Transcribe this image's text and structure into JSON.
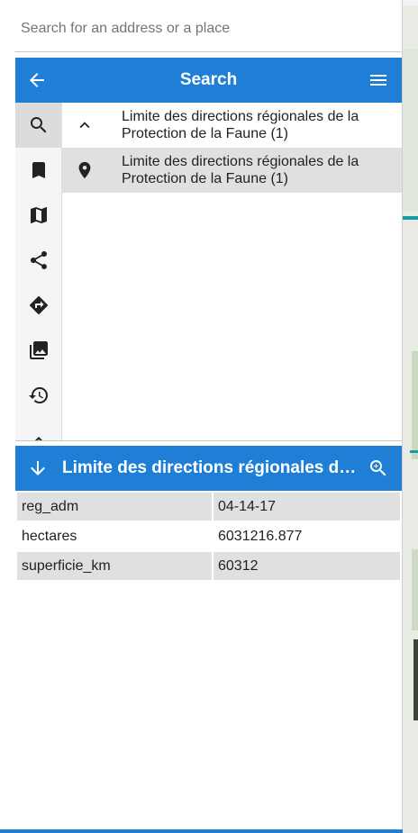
{
  "search": {
    "placeholder": "Search for an address or a place"
  },
  "header": {
    "title": "Search"
  },
  "sidebar": {
    "items": [
      {
        "icon": "search-icon",
        "active": true
      },
      {
        "icon": "bookmark-icon"
      },
      {
        "icon": "map-icon"
      },
      {
        "icon": "share-icon"
      },
      {
        "icon": "directions-icon"
      },
      {
        "icon": "image-gallery-icon"
      },
      {
        "icon": "history-icon"
      }
    ]
  },
  "results": {
    "group": {
      "label": "Limite des directions régionales de la Protection de la Faune (1)"
    },
    "item": {
      "label": "Limite des directions régionales de la Protection de la Faune (1)"
    }
  },
  "detail": {
    "title": "Limite des directions régionales de la Protection de la Faune",
    "attributes": [
      {
        "key": "reg_adm",
        "value": "04-14-17"
      },
      {
        "key": "hectares",
        "value": "6031216.877"
      },
      {
        "key": "superficie_km",
        "value": "60312"
      }
    ]
  },
  "colors": {
    "accent": "#1f7fd6",
    "selected_row": "#e0e0e0",
    "map_line": "#1b9aa0"
  }
}
